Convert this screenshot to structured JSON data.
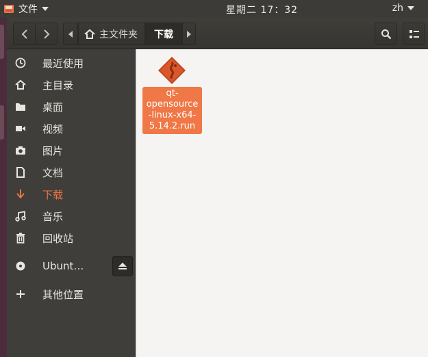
{
  "topbar": {
    "app_name": "文件",
    "clock": "星期二 17：32",
    "language": "zh"
  },
  "headerbar": {
    "path": {
      "home_label": "主文件夹",
      "current_label": "下载"
    }
  },
  "sidebar": {
    "items": [
      {
        "label": "最近使用",
        "icon": "clock-icon"
      },
      {
        "label": "主目录",
        "icon": "home-icon"
      },
      {
        "label": "桌面",
        "icon": "folder-icon"
      },
      {
        "label": "视频",
        "icon": "video-icon"
      },
      {
        "label": "图片",
        "icon": "camera-icon"
      },
      {
        "label": "文档",
        "icon": "document-icon"
      },
      {
        "label": "下载",
        "icon": "download-icon",
        "active": true
      },
      {
        "label": "音乐",
        "icon": "music-icon"
      },
      {
        "label": "回收站",
        "icon": "trash-icon"
      },
      {
        "label": "Ubunt…",
        "icon": "disc-icon"
      },
      {
        "label": "其他位置",
        "icon": "plus-icon"
      }
    ]
  },
  "files": [
    {
      "name": "qt-opensource-linux-x64-5.14.2.run",
      "display_lines": [
        "qt-",
        "opensource",
        "-linux-x64-",
        "5.14.2.run"
      ],
      "selected": true
    }
  ],
  "colors": {
    "accent": "#f07746",
    "sidebar_bg": "#3f3e3a",
    "main_bg": "#f5f4f2"
  }
}
